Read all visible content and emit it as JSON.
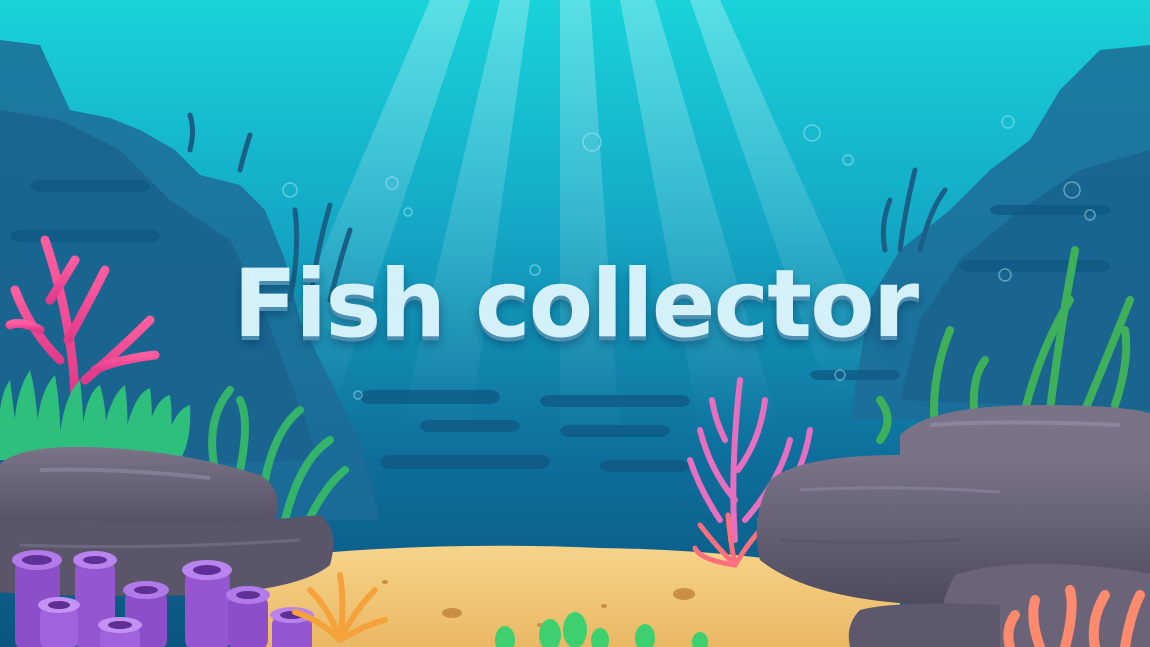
{
  "game": {
    "title": "Fish collector"
  },
  "scene": {
    "setting": "underwater",
    "colors": {
      "water_top": "#19d3da",
      "water_deep": "#0d5f8c",
      "sand": "#f2c877",
      "rock": "#6d6779",
      "rock_dark": "#4e4a5c",
      "title_fill": "#d4f0f8"
    }
  }
}
